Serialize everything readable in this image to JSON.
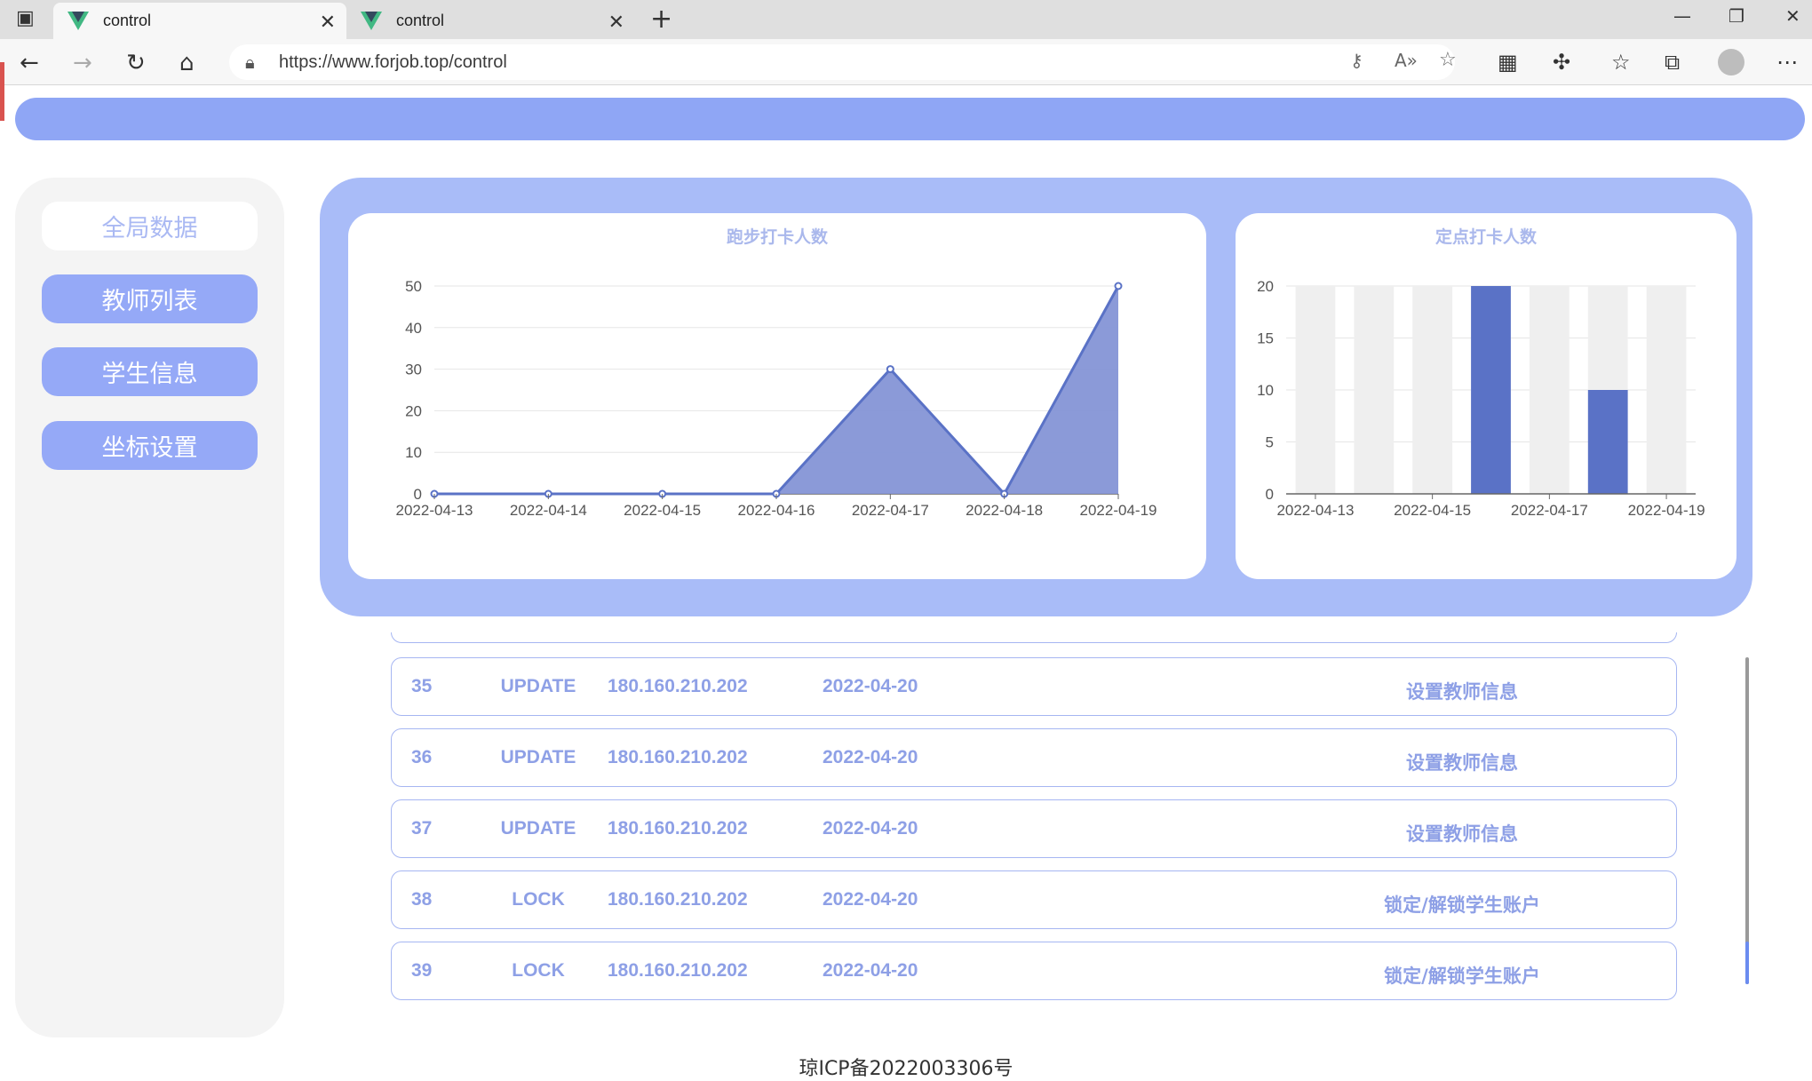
{
  "browser": {
    "tabs": [
      {
        "title": "control"
      },
      {
        "title": "control"
      }
    ],
    "url": "https://www.forjob.top/control"
  },
  "sidebar": {
    "items": [
      {
        "label": "全局数据"
      },
      {
        "label": "教师列表"
      },
      {
        "label": "学生信息"
      },
      {
        "label": "坐标设置"
      }
    ]
  },
  "colors": {
    "accent": "#8fa6f5",
    "panel": "#a9bcf8",
    "series": "#5a72c6",
    "area": "#8595d6"
  },
  "charts": {
    "running": {
      "title": "跑步打卡人数"
    },
    "point": {
      "title": "定点打卡人数"
    }
  },
  "chart_data": [
    {
      "type": "area",
      "title": "跑步打卡人数",
      "x": [
        "2022-04-13",
        "2022-04-14",
        "2022-04-15",
        "2022-04-16",
        "2022-04-17",
        "2022-04-18",
        "2022-04-19"
      ],
      "values": [
        0,
        0,
        0,
        0,
        30,
        0,
        50
      ],
      "ylim": [
        0,
        50
      ],
      "yticks": [
        0,
        10,
        20,
        30,
        40,
        50
      ],
      "grid": true
    },
    {
      "type": "bar",
      "title": "定点打卡人数",
      "categories": [
        "2022-04-13",
        "2022-04-14",
        "2022-04-15",
        "2022-04-16",
        "2022-04-17",
        "2022-04-18",
        "2022-04-19"
      ],
      "x_tick_labels": [
        "2022-04-13",
        "2022-04-15",
        "2022-04-17",
        "2022-04-19"
      ],
      "values": [
        0,
        0,
        0,
        20,
        0,
        10,
        0
      ],
      "ylim": [
        0,
        20
      ],
      "yticks": [
        0,
        5,
        10,
        15,
        20
      ],
      "background_bars": true
    }
  ],
  "log_rows": [
    {
      "id": "35",
      "op": "UPDATE",
      "ip": "180.160.210.202",
      "date": "2022-04-20",
      "desc": "设置教师信息"
    },
    {
      "id": "36",
      "op": "UPDATE",
      "ip": "180.160.210.202",
      "date": "2022-04-20",
      "desc": "设置教师信息"
    },
    {
      "id": "37",
      "op": "UPDATE",
      "ip": "180.160.210.202",
      "date": "2022-04-20",
      "desc": "设置教师信息"
    },
    {
      "id": "38",
      "op": "LOCK",
      "ip": "180.160.210.202",
      "date": "2022-04-20",
      "desc": "锁定/解锁学生账户"
    },
    {
      "id": "39",
      "op": "LOCK",
      "ip": "180.160.210.202",
      "date": "2022-04-20",
      "desc": "锁定/解锁学生账户"
    }
  ],
  "footer": {
    "text": "琼ICP备2022003306号"
  }
}
